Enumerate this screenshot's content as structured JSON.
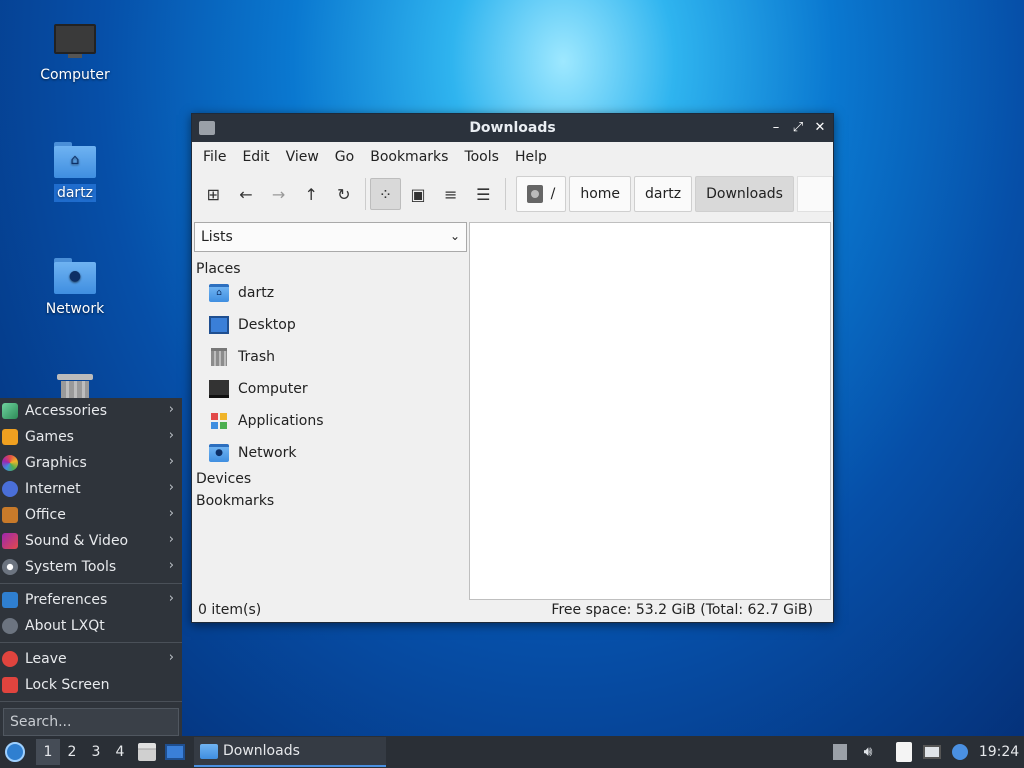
{
  "desktop": {
    "icons": [
      {
        "label": "Computer",
        "icon": "monitor-icon"
      },
      {
        "label": "dartz",
        "icon": "home-folder-icon"
      },
      {
        "label": "Network",
        "icon": "network-folder-icon"
      },
      {
        "label": "",
        "icon": "trash-icon"
      }
    ]
  },
  "window": {
    "title": "Downloads",
    "controls": {
      "minimize": "–",
      "maximize": "⤢",
      "close": "✕"
    },
    "menu": [
      "File",
      "Edit",
      "View",
      "Go",
      "Bookmarks",
      "Tools",
      "Help"
    ],
    "toolbar": {
      "new_tab": "⊞",
      "back": "←",
      "forward": "→",
      "up": "↑",
      "reload": "↻",
      "icon_view": "⁘",
      "thumb_view": "▣",
      "compact_view": "≡",
      "detail_view": "☰"
    },
    "breadcrumbs": [
      "/",
      "home",
      "dartz",
      "Downloads"
    ],
    "sidebar": {
      "mode": "Lists",
      "places_heading": "Places",
      "places": [
        "dartz",
        "Desktop",
        "Trash",
        "Computer",
        "Applications",
        "Network"
      ],
      "devices_heading": "Devices",
      "bookmarks_heading": "Bookmarks"
    },
    "status": {
      "items": "0 item(s)",
      "free_space": "Free space: 53.2 GiB (Total: 62.7 GiB)"
    }
  },
  "start_menu": {
    "categories": [
      "Accessories",
      "Games",
      "Graphics",
      "Internet",
      "Office",
      "Sound & Video",
      "System Tools"
    ],
    "settings": [
      "Preferences",
      "About LXQt"
    ],
    "session": [
      "Leave",
      "Lock Screen"
    ],
    "search_placeholder": "Search...",
    "chevron": "›"
  },
  "taskbar": {
    "desktops": [
      "1",
      "2",
      "3",
      "4"
    ],
    "task_label": "Downloads",
    "clock": "19:24"
  },
  "colors": {
    "titlebar": "#2b323c",
    "panel": "#2a2f36",
    "menu_bg": "#2f343b",
    "accent": "#4a90e2"
  }
}
